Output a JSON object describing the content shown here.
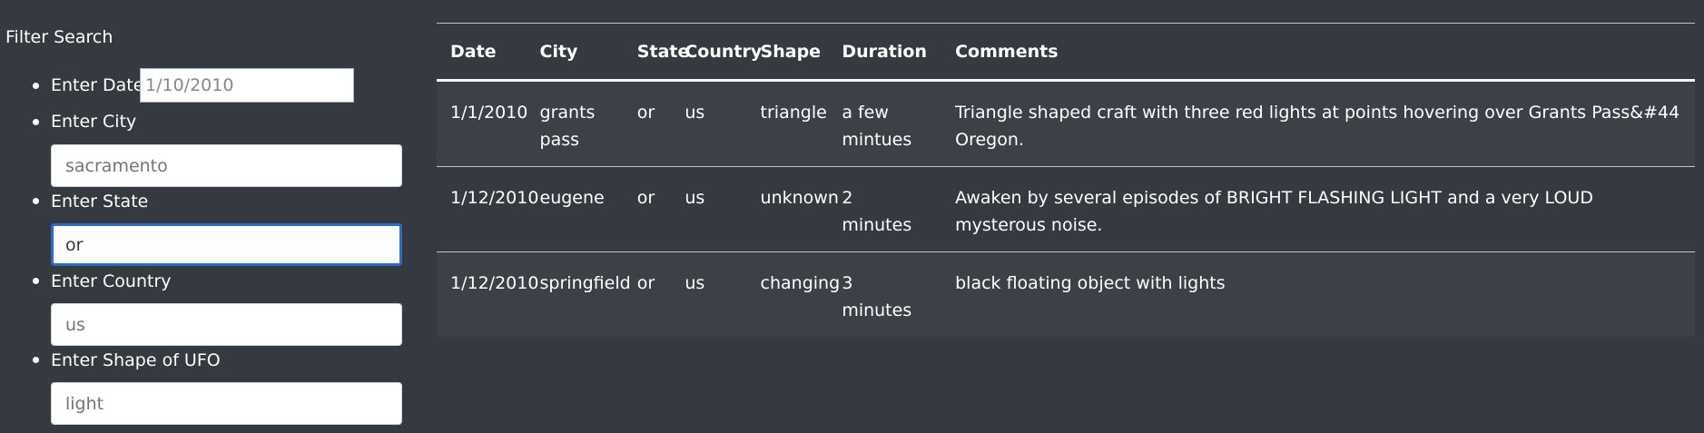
{
  "filter": {
    "title": "Filter Search",
    "items": [
      {
        "label": "Enter Date",
        "value": "1/10/2010",
        "placeholder": "1/10/2010"
      },
      {
        "label": "Enter City",
        "value": "",
        "placeholder": "sacramento"
      },
      {
        "label": "Enter State",
        "value": "or",
        "placeholder": ""
      },
      {
        "label": "Enter Country",
        "value": "",
        "placeholder": "us"
      },
      {
        "label": "Enter Shape of UFO",
        "value": "",
        "placeholder": "light"
      }
    ]
  },
  "table": {
    "headers": [
      "Date",
      "City",
      "State",
      "Country",
      "Shape",
      "Duration",
      "Comments"
    ],
    "rows": [
      [
        "1/1/2010",
        "grants pass",
        "or",
        "us",
        "triangle",
        "a few mintues",
        "Triangle shaped craft with three red lights at points hovering over Grants Pass&#44 Oregon."
      ],
      [
        "1/12/2010",
        "eugene",
        "or",
        "us",
        "unknown",
        "2 minutes",
        "Awaken by several episodes of BRIGHT FLASHING LIGHT and a very LOUD mysterous noise."
      ],
      [
        "1/12/2010",
        "springfield",
        "or",
        "us",
        "changing",
        "3 minutes",
        "black floating object with lights"
      ]
    ]
  }
}
